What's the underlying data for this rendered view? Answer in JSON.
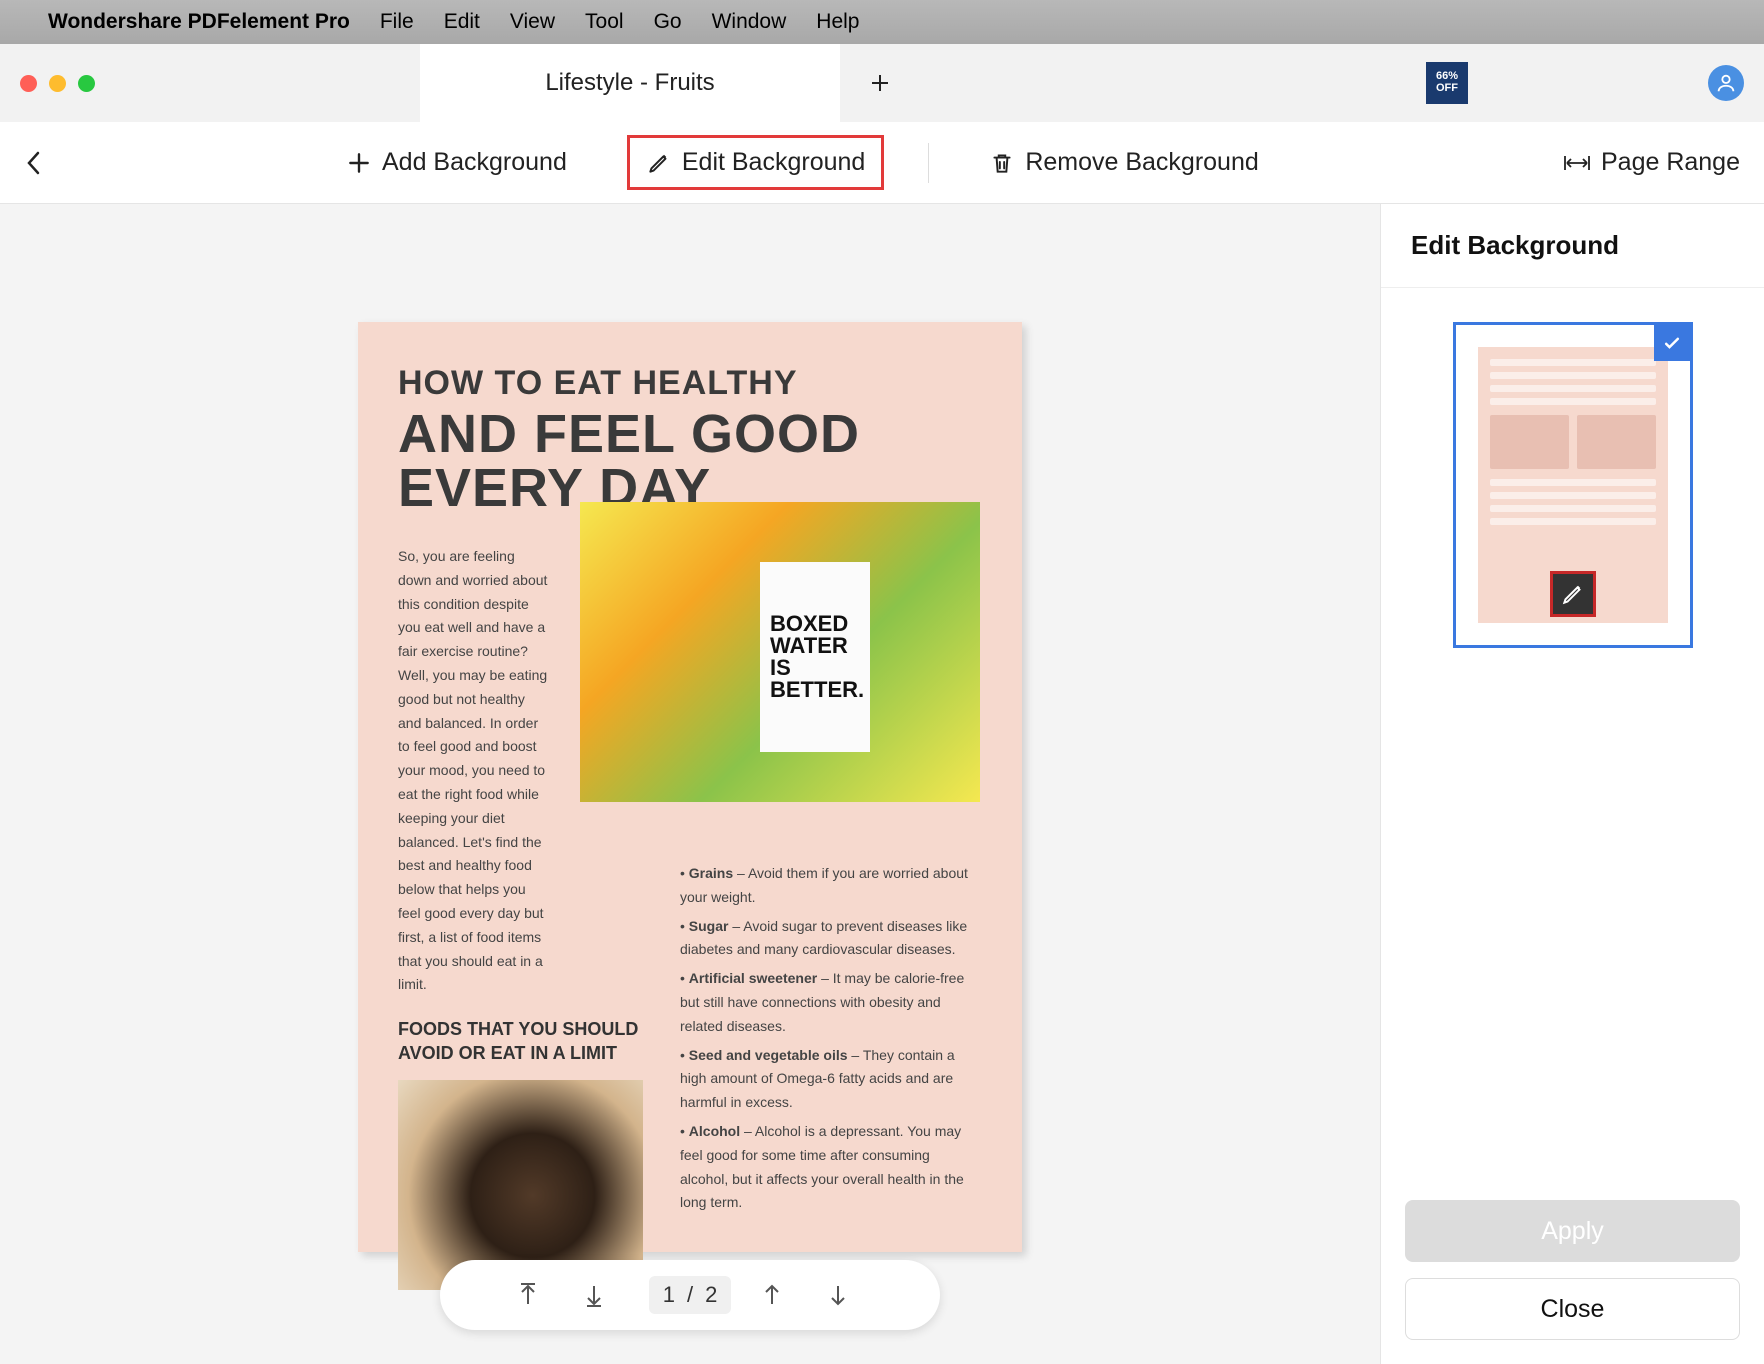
{
  "menubar": {
    "app_name": "Wondershare PDFelement Pro",
    "items": [
      "File",
      "Edit",
      "View",
      "Tool",
      "Go",
      "Window",
      "Help"
    ]
  },
  "tabbar": {
    "active_tab": "Lifestyle - Fruits",
    "promo": {
      "line1": "66%",
      "line2": "OFF"
    }
  },
  "toolbar": {
    "add_bg": "Add Background",
    "edit_bg": "Edit Background",
    "remove_bg": "Remove Background",
    "page_range": "Page Range"
  },
  "sidebar": {
    "title": "Edit Background",
    "apply": "Apply",
    "close": "Close"
  },
  "pager": {
    "current": "1",
    "sep": "/",
    "total": "2"
  },
  "document": {
    "title_line1": "HOW TO EAT HEALTHY",
    "title_line2": "AND FEEL GOOD EVERY DAY",
    "intro": "So, you are feeling down and worried about this condition despite you eat well and have a fair exercise routine? Well, you may be eating good but not healthy and balanced. In order to feel good and boost your mood, you need to eat the right food while keeping your diet balanced. Let's find the best and healthy food below that helps you feel good every day but first, a list of food items that you should eat in a limit.",
    "section1": "FOODS THAT YOU SHOULD AVOID OR EAT IN A LIMIT",
    "carton_l1": "BOXED",
    "carton_l2": "WATER",
    "carton_l3": "IS",
    "carton_l4": "BETTER.",
    "bullets": [
      {
        "t": "Grains",
        "d": " – Avoid them if you are worried about your weight."
      },
      {
        "t": "Sugar",
        "d": " – Avoid sugar to prevent diseases like diabetes and many cardiovascular diseases."
      },
      {
        "t": "Artificial sweetener",
        "d": " – It may be calorie-free but still have connections with obesity and related diseases."
      },
      {
        "t": "Seed and vegetable oils",
        "d": " – They contain a high amount of Omega-6 fatty acids and are harmful in excess."
      },
      {
        "t": "Alcohol",
        "d": " – Alcohol is a depressant. You may feel good for some time after consuming alcohol, but it affects your overall health in the long term."
      }
    ]
  }
}
